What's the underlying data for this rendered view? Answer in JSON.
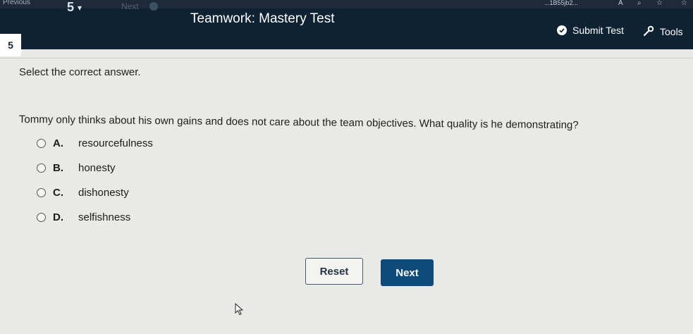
{
  "browser": {
    "back_label": "Previous",
    "url_fragment": "...1B55jb2...",
    "icons": [
      "text-size-icon",
      "zoom-icon",
      "favorite-add-icon",
      "favorites-icon"
    ]
  },
  "header": {
    "question_number_top": "5",
    "next_label": "Next",
    "title": "Teamwork: Mastery Test",
    "submit_label": "Submit Test",
    "tools_label": "Tools",
    "question_badge": "5"
  },
  "content": {
    "instruction": "Select the correct answer.",
    "question": "Tommy only thinks about his own gains and does not care about the team objectives. What quality is he demonstrating?",
    "options": [
      {
        "letter": "A.",
        "text": "resourcefulness"
      },
      {
        "letter": "B.",
        "text": "honesty"
      },
      {
        "letter": "C.",
        "text": "dishonesty"
      },
      {
        "letter": "D.",
        "text": "selfishness"
      }
    ]
  },
  "actions": {
    "reset_label": "Reset",
    "next_label": "Next"
  },
  "colors": {
    "header_bg": "#0e2233",
    "next_button_bg": "#0f4b7a",
    "page_bg": "#e9e9e6"
  }
}
